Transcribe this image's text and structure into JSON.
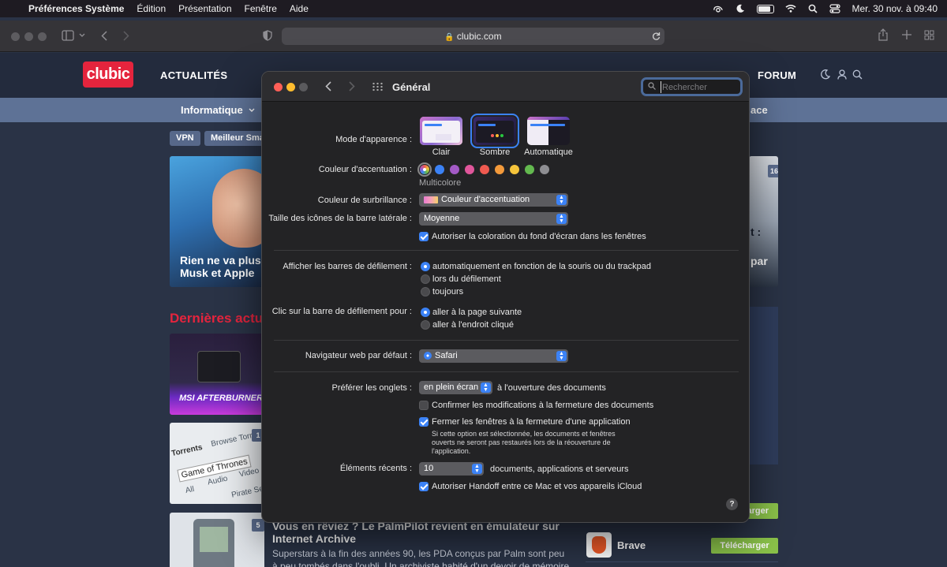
{
  "menubar": {
    "app_name": "Préférences Système",
    "items": [
      "Édition",
      "Présentation",
      "Fenêtre",
      "Aide"
    ],
    "clock": "Mer. 30 nov. à 09:40"
  },
  "safari": {
    "url": "clubic.com"
  },
  "site": {
    "logo": "clubic",
    "nav": [
      "ACTUALITÉS",
      "FORUM"
    ],
    "subnav_left": "Informatique",
    "subnav_right": "ace",
    "chips": [
      "VPN",
      "Meilleur Sma"
    ],
    "hero_left_caption_1": "Rien ne va plus e",
    "hero_left_caption_2": "Musk et Apple",
    "hero_right_badge": "16",
    "hero_right_caption_1": "t :",
    "hero_right_caption_2": "par",
    "latest_title": "Dernières actu",
    "thumb1_label": "MSI AFTERBURNER",
    "thumb2_texts": [
      "Torrents",
      "Browse Torre",
      "Game of Thrones",
      "All",
      "Audio",
      "Video",
      "Pirate Sea"
    ],
    "thumb2_badge": "1",
    "thumb3_badge": "5",
    "article_title": "Vous en rêviez ? Le PalmPilot revient en émulateur sur Internet Archive",
    "article_desc": "Superstars à la fin des années 90, les PDA conçus par Palm sont peu à peu tombés dans l'oubli. Un archiviste habité d'un devoir de mémoire",
    "download_label": "Télécharger",
    "download_partial": "harger",
    "brave_name": "Brave"
  },
  "prefs": {
    "title": "Général",
    "search_placeholder": "Rechercher",
    "appearance_label": "Mode d'apparence :",
    "themes": [
      "Clair",
      "Sombre",
      "Automatique"
    ],
    "accent_label": "Couleur d'accentuation :",
    "accent_colors": [
      "#3b82f6",
      "#a35ac6",
      "#e0569b",
      "#ef5a50",
      "#f39a3b",
      "#f5c43b",
      "#63b94f",
      "#8e8e92"
    ],
    "accent_selected_name": "Multicolore",
    "highlight_label": "Couleur de surbrillance :",
    "highlight_value": "Couleur d'accentuation",
    "sidebar_icon_label": "Taille des icônes de la barre latérale :",
    "sidebar_icon_value": "Moyenne",
    "wallpaper_tint": "Autoriser la coloration du fond d'écran dans les fenêtres",
    "scrollbars_label": "Afficher les barres de défilement :",
    "scrollbars_options": [
      "automatiquement en fonction de la souris ou du trackpad",
      "lors du défilement",
      "toujours"
    ],
    "click_label": "Clic sur la barre de défilement pour :",
    "click_options": [
      "aller à la page suivante",
      "aller à l'endroit cliqué"
    ],
    "browser_label": "Navigateur web par défaut :",
    "browser_value": "Safari",
    "tabs_label": "Préférer les onglets :",
    "tabs_value": "en plein écran",
    "tabs_suffix": "à l'ouverture des documents",
    "confirm_changes": "Confirmer les modifications à la fermeture des documents",
    "close_windows": "Fermer les fenêtres à la fermeture d'une application",
    "close_windows_note": "Si cette option est sélectionnée, les documents et fenêtres ouverts ne seront pas restaurés lors de la réouverture de l'application.",
    "recent_label": "Éléments récents :",
    "recent_value": "10",
    "recent_suffix": "documents, applications et serveurs",
    "handoff": "Autoriser Handoff entre ce Mac et vos appareils iCloud",
    "help": "?"
  }
}
